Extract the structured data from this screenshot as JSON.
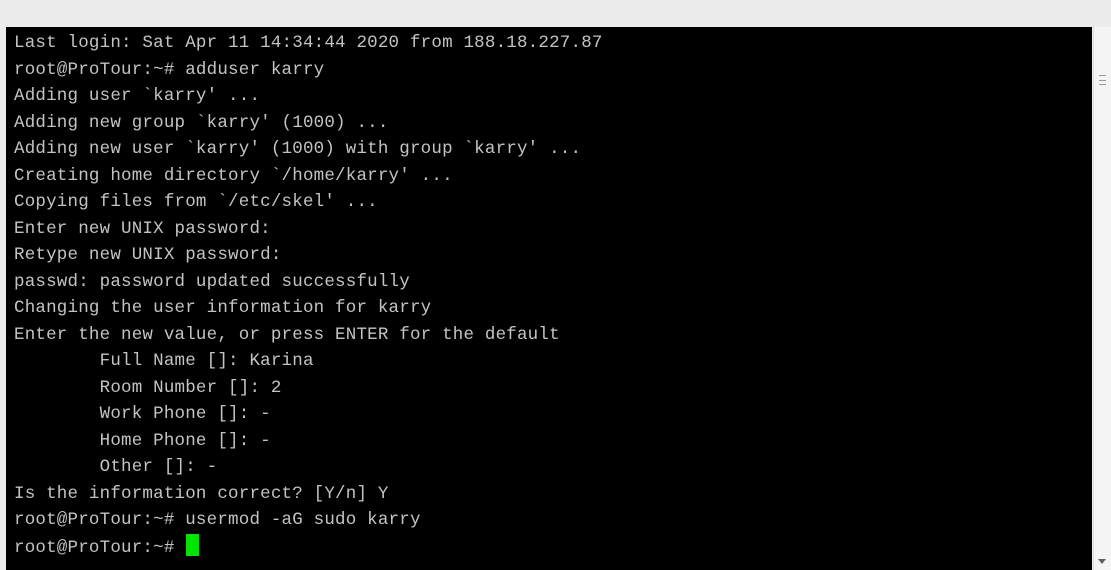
{
  "terminal": {
    "lines": [
      "Last login: Sat Apr 11 14:34:44 2020 from 188.18.227.87",
      "root@ProTour:~# adduser karry",
      "Adding user `karry' ...",
      "Adding new group `karry' (1000) ...",
      "Adding new user `karry' (1000) with group `karry' ...",
      "Creating home directory `/home/karry' ...",
      "Copying files from `/etc/skel' ...",
      "Enter new UNIX password:",
      "Retype new UNIX password:",
      "passwd: password updated successfully",
      "Changing the user information for karry",
      "Enter the new value, or press ENTER for the default",
      "        Full Name []: Karina",
      "        Room Number []: 2",
      "        Work Phone []: -",
      "        Home Phone []: -",
      "        Other []: -",
      "Is the information correct? [Y/n] Y",
      "root@ProTour:~# usermod -aG sudo karry"
    ],
    "prompt": "root@ProTour:~# ",
    "cursor_color": "#00e400",
    "text_color": "#c3c3c3",
    "background_color": "#000000"
  },
  "scrollbar": {
    "grip_icon": "scrollbar-grip-icon",
    "down_icon": "scroll-down-arrow-icon"
  }
}
